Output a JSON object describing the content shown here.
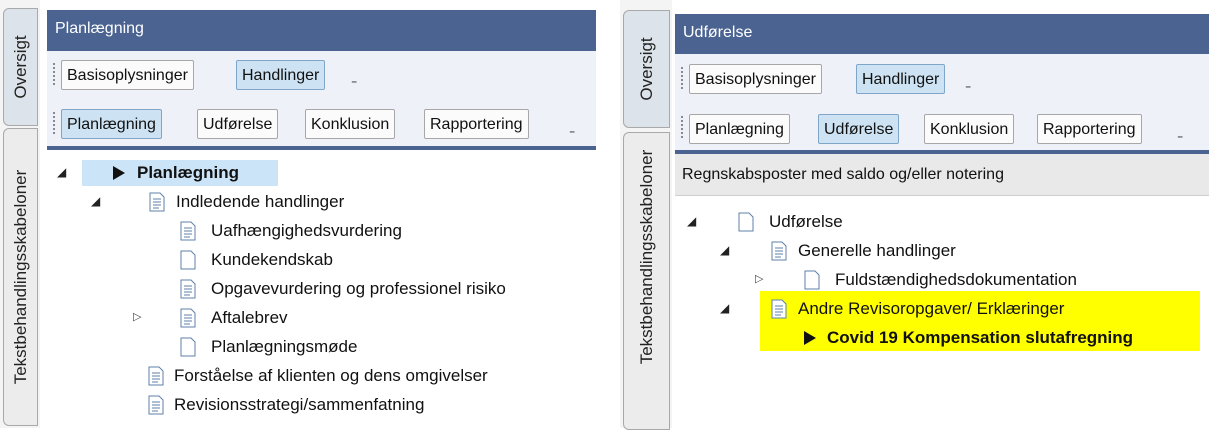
{
  "left": {
    "side_tabs": [
      "Oversigt",
      "Tekstbehandlingsskabeloner"
    ],
    "header": "Planlægning",
    "toolbar1": [
      "Basisoplysninger",
      "Handlinger"
    ],
    "toolbar2": [
      "Planlægning",
      "Udførelse",
      "Konklusion",
      "Rapportering"
    ],
    "overflow_glyph": "₌",
    "tree": [
      {
        "label": "Planlægning",
        "expander": "◢",
        "icon": "play-icon"
      },
      {
        "label": "Indledende handlinger",
        "expander": "◢",
        "icon": "document-icon"
      },
      {
        "label": "Uafhængighedsvurdering",
        "icon": "document-icon"
      },
      {
        "label": "Kundekendskab",
        "icon": "blank-document-icon"
      },
      {
        "label": "Opgavevurdering og professionel risiko",
        "icon": "document-icon"
      },
      {
        "label": "Aftalebrev",
        "expander": "▷",
        "icon": "document-icon"
      },
      {
        "label": "Planlægningsmøde",
        "icon": "blank-document-icon"
      },
      {
        "label": "Forståelse af klienten og dens omgivelser",
        "icon": "document-icon"
      },
      {
        "label": "Revisionsstrategi/sammenfatning",
        "icon": "document-icon"
      }
    ]
  },
  "right": {
    "side_tabs": [
      "Oversigt",
      "Tekstbehandlingsskabeloner"
    ],
    "header": "Udførelse",
    "toolbar1": [
      "Basisoplysninger",
      "Handlinger"
    ],
    "toolbar2": [
      "Planlægning",
      "Udførelse",
      "Konklusion",
      "Rapportering"
    ],
    "overflow_glyph": "₌",
    "infobar": "Regnskabsposter med saldo og/eller notering",
    "tree": [
      {
        "label": "Udførelse",
        "expander": "◢",
        "icon": "blank-document-icon"
      },
      {
        "label": "Generelle handlinger",
        "expander": "◢",
        "icon": "document-icon"
      },
      {
        "label": "Fuldstændighedsdokumentation",
        "expander": "▷",
        "icon": "blank-document-icon"
      },
      {
        "label": "Andre Revisoropgaver/ Erklæringer",
        "expander": "◢",
        "icon": "document-icon"
      },
      {
        "label": "Covid 19 Kompensation slutafregning",
        "icon": "play-icon"
      }
    ],
    "highlight_color": "#ffff00"
  },
  "colors": {
    "header": "#4a6391",
    "selected_button": "#cde3f3",
    "selected_node": "#cce4f7"
  }
}
